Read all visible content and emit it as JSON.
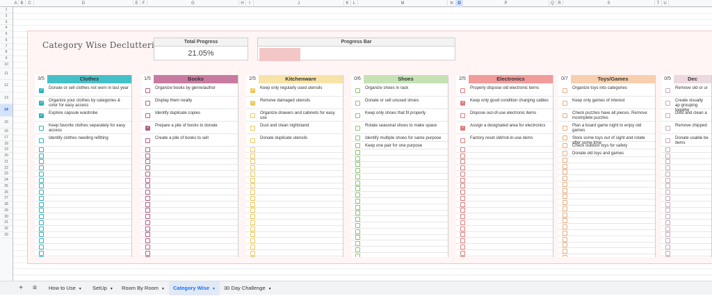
{
  "columns": [
    "A",
    "B",
    "C",
    "D",
    "E",
    "F",
    "G",
    "H",
    "I",
    "J",
    "K",
    "L",
    "M",
    "N",
    "O",
    "P",
    "Q",
    "R",
    "S",
    "T",
    "U"
  ],
  "selected_column": "O",
  "rows": [
    "1",
    "2",
    "3",
    "4",
    "5",
    "6",
    "7",
    "8",
    "9",
    "10",
    "11",
    "12",
    "13",
    "14",
    "15",
    "16",
    "17",
    "18",
    "19",
    "20",
    "21",
    "22",
    "23",
    "24",
    "25",
    "26",
    "27",
    "28",
    "29",
    "30",
    "31",
    "32",
    "33"
  ],
  "selected_row": "14",
  "title": "Category Wise Decluttering",
  "total_progress": {
    "label": "Total Progress",
    "value": "21.05%",
    "fraction": 0.2105
  },
  "progress_bar": {
    "label": "Progress Bar"
  },
  "categories": [
    {
      "name": "Clothes",
      "count": "3/5",
      "color": "#45c0c9",
      "cb_color": "#2bb3bd",
      "items": [
        {
          "text": "Donate or sell clothes not worn in last year",
          "checked": true
        },
        {
          "text": "Organize your clothes by categories & color for easy access",
          "checked": true
        },
        {
          "text": "Explore capsule wardrobe",
          "checked": true
        },
        {
          "text": "Keep favorite clothes separately for easy access",
          "checked": false
        },
        {
          "text": "Identify clothes needing refitting",
          "checked": false
        }
      ]
    },
    {
      "name": "Books",
      "count": "1/5",
      "color": "#c87ba0",
      "cb_color": "#b05d87",
      "items": [
        {
          "text": "Organize books by genre/author",
          "checked": false
        },
        {
          "text": "Display them neatly",
          "checked": false
        },
        {
          "text": "Identify duplicate copies",
          "checked": false
        },
        {
          "text": "Prepare a pile of books to donate",
          "checked": true
        },
        {
          "text": "Create a pile of books to sell",
          "checked": false
        }
      ]
    },
    {
      "name": "Kitchenware",
      "count": "2/5",
      "color": "#f7e3a8",
      "cb_color": "#edc95a",
      "items": [
        {
          "text": "Keep only regularly used utensils",
          "checked": true
        },
        {
          "text": "Remove damaged utensils",
          "checked": true
        },
        {
          "text": "Organize drawers and cabinets for easy use",
          "checked": false
        },
        {
          "text": "Dust and clean nightstand",
          "checked": false
        },
        {
          "text": "Donate duplicate utensils",
          "checked": false
        }
      ]
    },
    {
      "name": "Shoes",
      "count": "0/6",
      "color": "#c5e2b4",
      "cb_color": "#8fbf72",
      "items": [
        {
          "text": "Organize shoes in rack",
          "checked": false
        },
        {
          "text": "Donate or sell unused shoes",
          "checked": false
        },
        {
          "text": "Keep only shoes that fit properly",
          "checked": false
        },
        {
          "text": "Rotate seasonal shoes to make space",
          "checked": false
        },
        {
          "text": "Identify multiple shoes for same purpose",
          "checked": false
        },
        {
          "text": "Keep one pair for one purpose",
          "checked": false
        }
      ]
    },
    {
      "name": "Electronics",
      "count": "2/5",
      "color": "#f19b9b",
      "cb_color": "#e07a7a",
      "items": [
        {
          "text": "Properly dispose old electronic items",
          "checked": false
        },
        {
          "text": "Keep only good condition charging cables",
          "checked": true
        },
        {
          "text": "Dispose out-of-use electronic items",
          "checked": false
        },
        {
          "text": "Assign a designated area for electronics",
          "checked": true
        },
        {
          "text": "Factory reset old/not-in-use items",
          "checked": false
        }
      ]
    },
    {
      "name": "Toys/Games",
      "count": "0/7",
      "color": "#f7cfae",
      "cb_color": "#e9ad7c",
      "items": [
        {
          "text": "Organize toys into categories",
          "checked": false
        },
        {
          "text": "Keep only games of interest",
          "checked": false
        },
        {
          "text": "Check puzzles have all pieces. Remove incomplete puzzles",
          "checked": false
        },
        {
          "text": "Plan a board game night to enjoy old games",
          "checked": false
        },
        {
          "text": "Store some toys out of sight and rotate after some time",
          "checked": false
        },
        {
          "text": "Check outdoor toys for safety",
          "checked": false
        },
        {
          "text": "Donate old toys and games",
          "checked": false
        }
      ]
    },
    {
      "name": "Dec",
      "count": "0/5",
      "color": "#ecd9df",
      "cb_color": "#c9a9b5",
      "items": [
        {
          "text": "Remove old or ur",
          "checked": false
        },
        {
          "text": "Create visually ap grouping togethe",
          "checked": false
        },
        {
          "text": "Dust and clean a",
          "checked": false
        },
        {
          "text": "Remove chipped",
          "checked": false
        },
        {
          "text": "Donate usable be items",
          "checked": false
        }
      ]
    }
  ],
  "tabs": {
    "add_icon": "+",
    "menu_icon": "≡",
    "items": [
      {
        "label": "How to Use",
        "active": false
      },
      {
        "label": "SetUp",
        "active": false
      },
      {
        "label": "Room By Room",
        "active": false
      },
      {
        "label": "Category Wise",
        "active": true
      },
      {
        "label": "30 Day Challenge",
        "active": false
      }
    ]
  }
}
